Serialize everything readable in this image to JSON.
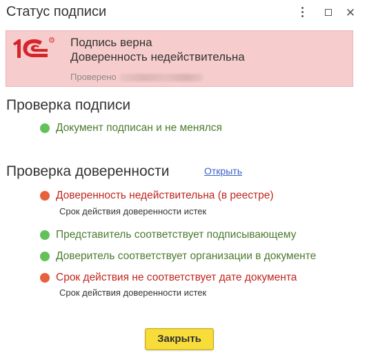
{
  "window": {
    "title": "Статус подписи"
  },
  "banner": {
    "line1": "Подпись верна",
    "line2": "Доверенность недействительна",
    "checked_label": "Проверено"
  },
  "signature_check": {
    "heading": "Проверка подписи",
    "items": [
      {
        "status": "ok",
        "text": "Документ подписан и не менялся"
      }
    ]
  },
  "poa_check": {
    "heading": "Проверка доверенности",
    "open_link": "Открыть",
    "items": [
      {
        "status": "error",
        "text": "Доверенность недействительна (в реестре)",
        "detail": "Срок действия доверенности истек"
      },
      {
        "status": "ok",
        "text": "Представитель соответствует подписывающему"
      },
      {
        "status": "ok",
        "text": "Доверитель соответствует организации в документе"
      },
      {
        "status": "error",
        "text": "Срок действия не соответствует дате документа",
        "detail": "Срок действия доверенности истек"
      }
    ]
  },
  "footer": {
    "close_label": "Закрыть"
  },
  "colors": {
    "banner_bg": "#f7cccc",
    "ok_dot": "#64c15a",
    "error_dot": "#e8603c",
    "ok_text": "#4a7a2e",
    "error_text": "#c0241c",
    "button_bg": "#f7dc3a",
    "logo_red": "#d4252b"
  },
  "icons": {
    "menu": "more-vertical-icon",
    "maximize": "maximize-icon",
    "close": "close-icon",
    "logo": "1c-logo"
  }
}
